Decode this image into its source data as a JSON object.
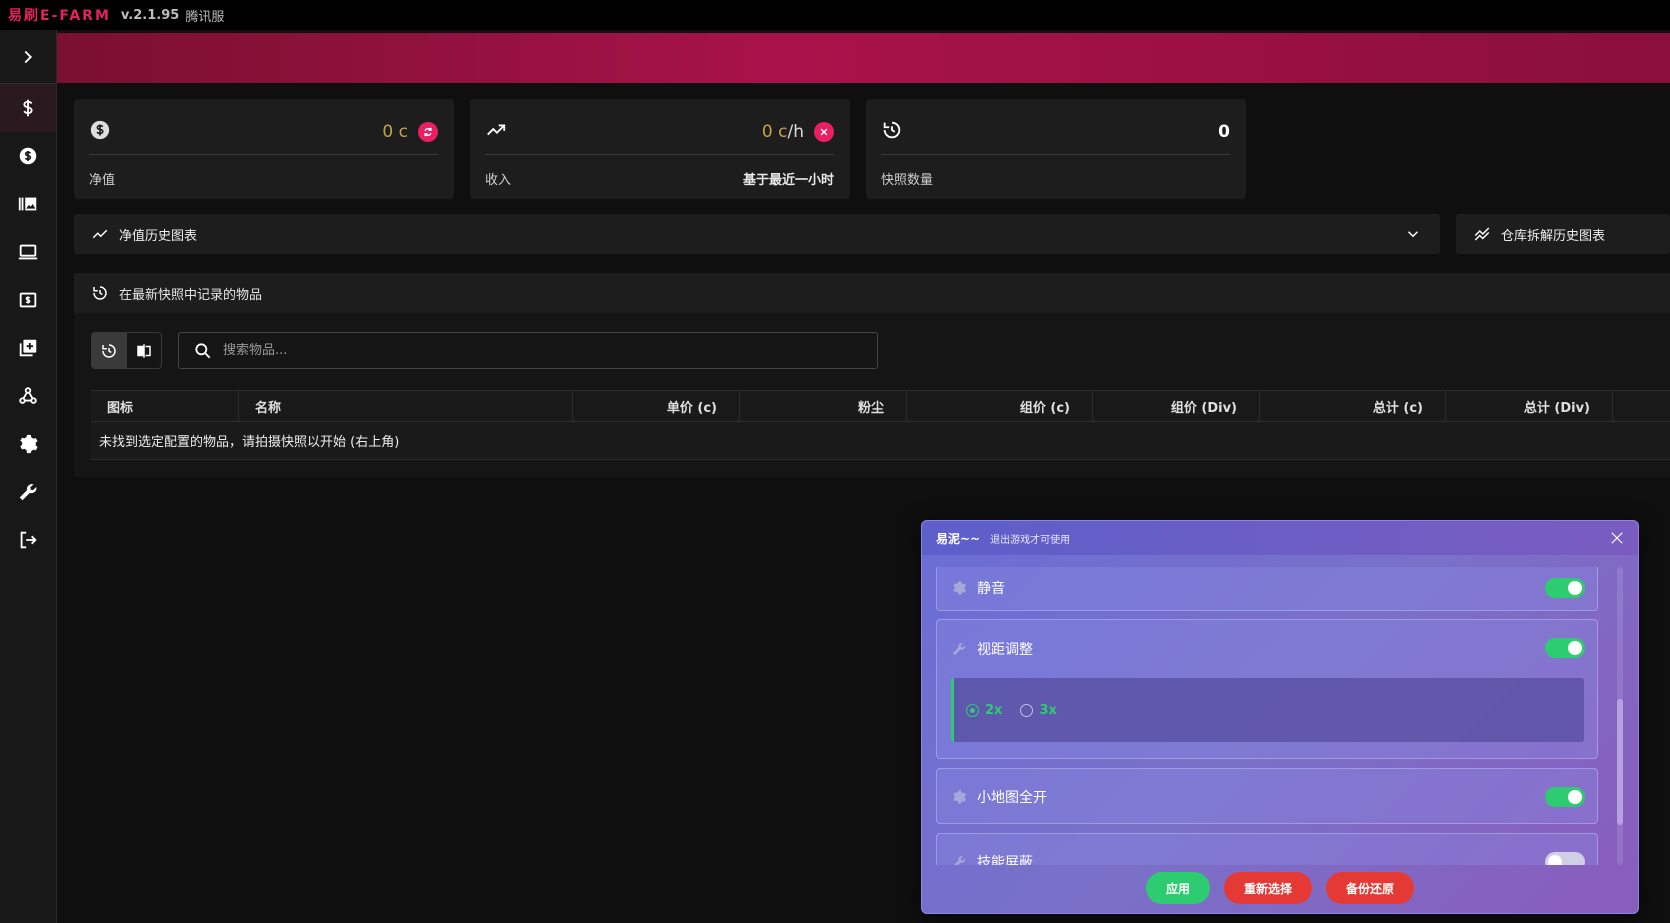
{
  "titlebar": {
    "brand": "易刷E-FARM",
    "version": "v.2.1.95",
    "server": "腾讯服"
  },
  "cards": [
    {
      "value": "0",
      "unit": "c",
      "suffix": "",
      "label": "净值",
      "right": ""
    },
    {
      "value": "0",
      "unit": "c",
      "suffix": "/h",
      "label": "收入",
      "right": "基于最近一小时"
    },
    {
      "value": "0",
      "unit": "",
      "suffix": "",
      "label": "快照数量",
      "right": ""
    }
  ],
  "panels": {
    "networth_chart": "净值历史图表",
    "warehouse_chart": "仓库拆解历史图表",
    "items_title": "在最新快照中记录的物品"
  },
  "search": {
    "placeholder": "搜索物品..."
  },
  "table": {
    "columns": [
      "图标",
      "名称",
      "单价 (c)",
      "粉尘",
      "组价 (c)",
      "组价 (Div)",
      "总计 (c)",
      "总计 (Div)"
    ],
    "empty": "未找到选定配置的物品，请拍摄快照以开始 (右上角)"
  },
  "dialog": {
    "title": "易泥~~",
    "subtitle": "退出游戏才可使用",
    "options": [
      {
        "label": "静音",
        "enabled": true
      },
      {
        "label": "视距调整",
        "enabled": true
      },
      {
        "label": "小地图全开",
        "enabled": true
      },
      {
        "label": "技能屏蔽",
        "enabled": false
      }
    ],
    "zoom_options": [
      "2x",
      "3x"
    ],
    "zoom_selected": "2x",
    "buttons": {
      "apply": "应用",
      "reselect": "重新选择",
      "backup": "备份还原"
    }
  },
  "colors": {
    "accent": "#e91e63",
    "banner": "#a8124a",
    "green": "#2ecc71",
    "gold": "#c8a24a"
  }
}
